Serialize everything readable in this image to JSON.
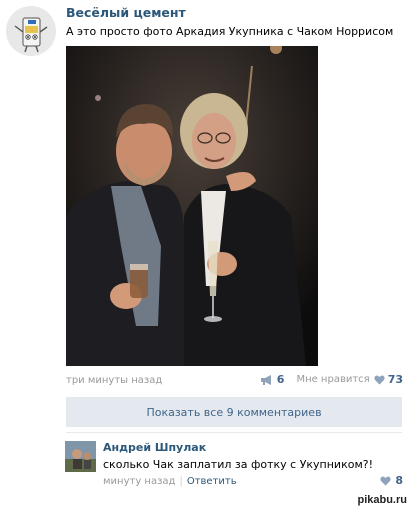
{
  "post": {
    "author": "Весёлый цемент",
    "text": "А это просто фото Аркадия Укупника с Чаком Норрисом",
    "time": "три минуты назад",
    "reposts_count": "6",
    "like_label": "Мне нравится",
    "likes_count": "73",
    "show_comments": "Показать все 9 комментариев"
  },
  "comment": {
    "author": "Андрей Шпулак",
    "text": "сколько Чак заплатил за фотку с Укупником?!",
    "time": "минуту назад",
    "reply": "Ответить",
    "likes_count": "8"
  },
  "watermark": "pikabu.ru",
  "colors": {
    "link": "#2b587a",
    "accent": "#42648b",
    "button_bg": "#e3e9ef",
    "muted": "#999999"
  },
  "icons": [
    "cement-mascot-avatar",
    "megaphone-icon",
    "heart-icon"
  ]
}
